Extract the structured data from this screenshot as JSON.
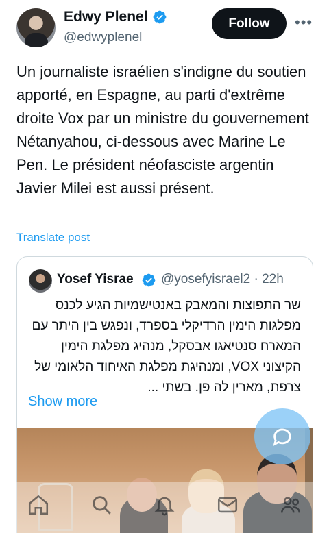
{
  "author": {
    "name": "Edwy Plenel",
    "handle": "@edwyplenel",
    "follow_label": "Follow",
    "more_glyph": "•••",
    "avatar_icon": "user-avatar"
  },
  "tweet": {
    "text": "Un journaliste israélien s'indigne du soutien apporté, en Espagne, au parti d'extrême droite Vox par un ministre du gouvernement Nétanyahou, ci-dessous avec Marine Le Pen. Le président néofasciste argentin Javier Milei est aussi présent.",
    "translate_label": "Translate post"
  },
  "quoted": {
    "name": "Yosef Yisrae",
    "handle": "@yosefyisrael2",
    "separator": "·",
    "time": "22h",
    "text": "שר התפוצות והמאבק באנטישמיות הגיע לכנס מפלגות הימין הרדיקלי בספרד, ונפגש בין היתר עם המארח סנטיאגו אבסקל, מנהיג מפלגת הימין הקיצוני VOX, ומנהיגת מפלגת האיחוד הלאומי של צרפת, מארין לה פן. בשתי ...",
    "show_more_label": "Show more"
  },
  "colors": {
    "accent": "#1d9bf0",
    "text": "#0f1419",
    "secondary": "#536471",
    "follow_bg": "#0f1419"
  },
  "nav": {
    "items": [
      "home-icon",
      "search-icon",
      "notifications-icon",
      "messages-icon",
      "communities-icon"
    ]
  },
  "fab": {
    "icon": "new-post-icon"
  }
}
